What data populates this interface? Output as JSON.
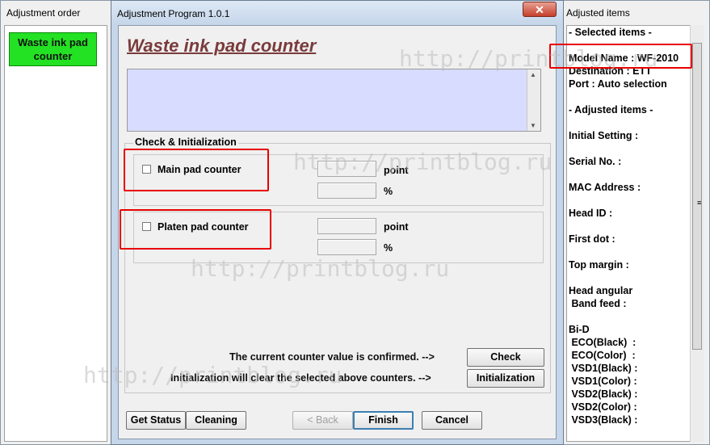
{
  "left_window": {
    "title": "Adjustment order",
    "waste_button_line1": "Waste ink pad",
    "waste_button_line2": "counter"
  },
  "dialog": {
    "title": "Adjustment Program 1.0.1",
    "close_glyph": "✕",
    "heading": "Waste ink pad counter",
    "group_label": "Check & Initialization",
    "main_pad": {
      "label": "Main pad counter",
      "unit_point": "point",
      "unit_percent": "%",
      "checked": false
    },
    "platen_pad": {
      "label": "Platen pad counter",
      "unit_point": "point",
      "unit_percent": "%",
      "checked": false
    },
    "check_message": "The current counter value is confirmed. -->",
    "init_message": "Initialization will clear the selected above counters. -->",
    "buttons": {
      "check": "Check",
      "initialization": "Initialization",
      "get_status": "Get Status",
      "cleaning": "Cleaning",
      "back": "< Back",
      "finish": "Finish",
      "cancel": "Cancel"
    }
  },
  "right_window": {
    "title": "Adjusted items",
    "rows": [
      "- Selected items -",
      "Model Name : WF-2010",
      "Destination : ETT",
      "Port : Auto selection",
      "- Adjusted items -",
      "Initial Setting :",
      "Serial No. :",
      "MAC Address :",
      "Head ID :",
      "First dot :",
      "Top margin :",
      "Head angular",
      " Band feed :",
      "Bi-D",
      " ECO(Black)  :",
      " ECO(Color)  :",
      " VSD1(Black) :",
      " VSD1(Color) :",
      " VSD2(Black) :",
      " VSD2(Color) :",
      " VSD3(Black) :"
    ]
  },
  "watermark": "http://printblog.ru",
  "colors": {
    "highlight_box": "#e80000",
    "heading": "#7a3b3b",
    "memo_bg": "#d8dcff",
    "waste_button": "#23e123"
  }
}
